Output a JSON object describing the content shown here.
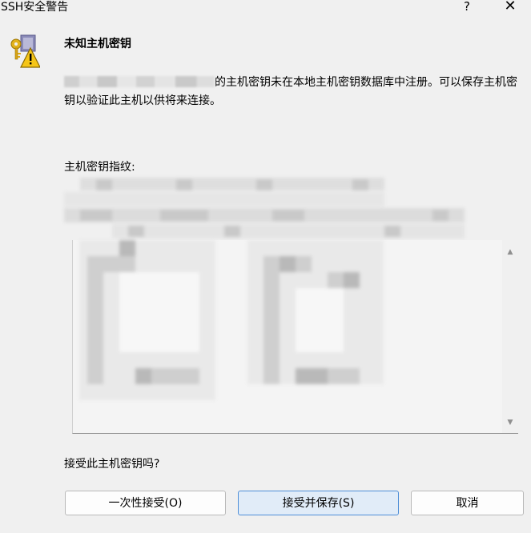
{
  "window": {
    "title": "SSH安全警告",
    "help_label": "?",
    "close_label": "✕"
  },
  "icons": {
    "header": "warning-key-icon",
    "scroll_up": "scroll-up-arrow-icon",
    "scroll_down": "scroll-down-arrow-icon"
  },
  "dialog": {
    "heading": "未知主机密钥",
    "message_text": "的主机密钥未在本地主机密钥数据库中注册。可以保存主机密钥以验证此主机以供将来连接。",
    "fingerprint_label": "主机密钥指纹:",
    "prompt": "接受此主机密钥吗?"
  },
  "buttons": {
    "accept_once": "一次性接受(O)",
    "accept_save": "接受并保存(S)",
    "cancel": "取消"
  },
  "colors": {
    "window_bg": "#f0f0f0",
    "default_button_border": "#4f8fd8",
    "default_button_bg": "#e1ecf8"
  }
}
